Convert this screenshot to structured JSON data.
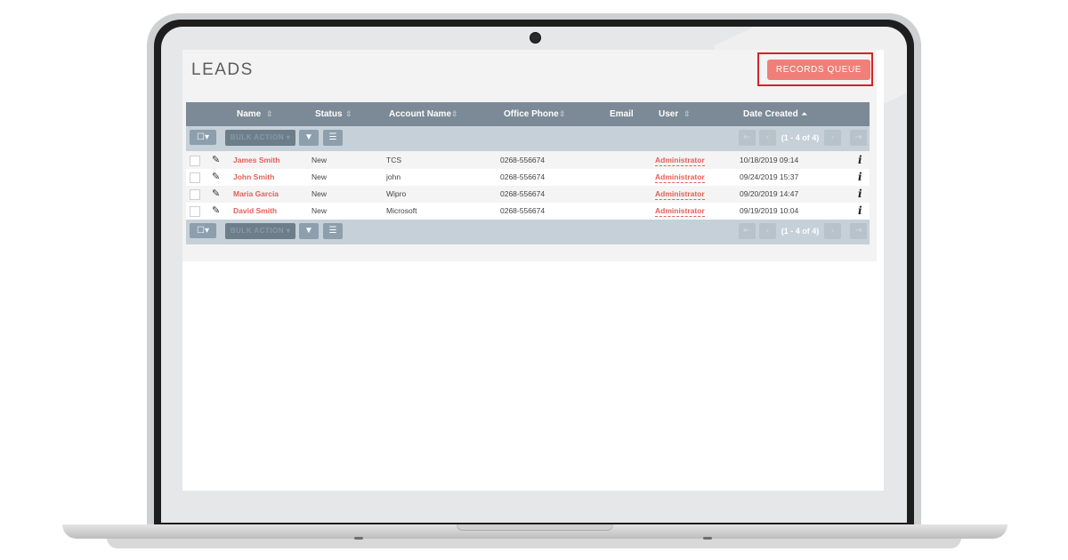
{
  "page": {
    "title": "LEADS",
    "records_queue_label": "RECORDS QUEUE",
    "accent_color": "#ef7f78",
    "highlight_color": "#d2232a"
  },
  "table": {
    "columns": [
      {
        "label": "Name",
        "sortable": true
      },
      {
        "label": "Status",
        "sortable": true
      },
      {
        "label": "Account Name",
        "sortable": true
      },
      {
        "label": "Office Phone",
        "sortable": true
      },
      {
        "label": "Email",
        "sortable": false
      },
      {
        "label": "User",
        "sortable": true
      },
      {
        "label": "Date Created",
        "sortable": true,
        "sorted": true
      }
    ],
    "rows": [
      {
        "name": "James Smith",
        "status": "New",
        "account": "TCS",
        "phone": "0268-556674",
        "email": "",
        "user": "Administrator",
        "date": "10/18/2019 09:14"
      },
      {
        "name": "John Smith",
        "status": "New",
        "account": "john",
        "phone": "0268-556674",
        "email": "",
        "user": "Administrator",
        "date": "09/24/2019 15:37"
      },
      {
        "name": "Maria Garcia",
        "status": "New",
        "account": "Wipro",
        "phone": "0268-556674",
        "email": "",
        "user": "Administrator",
        "date": "09/20/2019 14:47"
      },
      {
        "name": "David Smith",
        "status": "New",
        "account": "Microsoft",
        "phone": "0268-556674",
        "email": "",
        "user": "Administrator",
        "date": "09/19/2019 10:04"
      }
    ]
  },
  "toolbar": {
    "bulk_action_label": "BULK ACTION",
    "pagination_text": "(1 - 4 of 4)",
    "select_icon": "checkbox-dropdown-icon",
    "filter_icon": "filter-icon",
    "columns_icon": "list-icon"
  },
  "row_icons": {
    "edit_icon": "pencil-icon",
    "info_icon": "info-icon"
  }
}
